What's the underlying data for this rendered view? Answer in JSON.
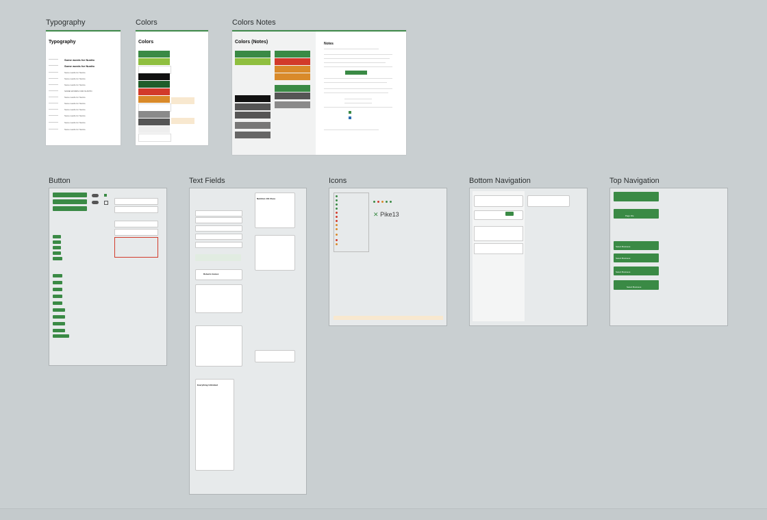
{
  "sections": {
    "typography": {
      "title": "Typography",
      "heading": "Typography",
      "samples": [
        "Some words for Nunito",
        "Some words for Nunito",
        "Some words for Nunito",
        "Some words for Nunito",
        "Some words for Nunito",
        "SOME WORDS FOR NUNITO",
        "Some words for Nunito",
        "Some words for Nunito",
        "Some words for Nunito",
        "Some words for Nunito",
        "Some words for Nunito",
        "Some words for Nunito"
      ]
    },
    "colors": {
      "title": "Colors",
      "heading": "Colors"
    },
    "colors_notes": {
      "title": "Colors Notes",
      "heading": "Colors (Notes)",
      "notes_heading": "Notes"
    },
    "button": {
      "title": "Button"
    },
    "text_fields": {
      "title": "Text Fields",
      "card_title": "Nutrition 101 Class",
      "profile_name": "Roberto Gomez",
      "list_title": "Everything Unlimited"
    },
    "icons": {
      "title": "Icons",
      "brand": "Pike13"
    },
    "bottom_navigation": {
      "title": "Bottom Navigation"
    },
    "top_navigation": {
      "title": "Top Navigation",
      "select_business": "Select Business",
      "page_title": "Page title"
    }
  },
  "palette": {
    "green": "#3a8a45",
    "light_green": "#8fbf3f",
    "red": "#d23a2a",
    "orange": "#d98a2a",
    "black": "#111111",
    "grey": "#8a8a8a",
    "dark_grey": "#555555",
    "background": "#c9cfd1"
  }
}
